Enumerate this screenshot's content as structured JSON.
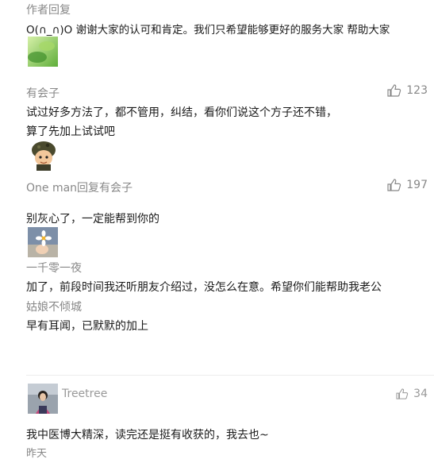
{
  "comments": [
    {
      "author": "作者回复",
      "text": "O(∩_∩)O 谢谢大家的认可和肯定。我们只希望能够更好的服务大家 帮助大家",
      "avatar": "green-leaf-avatar"
    },
    {
      "author": "有会子",
      "likes": "123",
      "text_lines": [
        "试过好多方法了，都不管用，纠结，看你们说这个方子还不错，",
        "算了先加上试试吧"
      ],
      "avatar": "cartoon-soldier-avatar"
    },
    {
      "author": "One man回复有会子",
      "likes": "197",
      "text": "别灰心了，一定能帮到你的",
      "avatar": "flower-hand-avatar"
    },
    {
      "author": "一千零一夜",
      "text": "加了，前段时间我还听朋友介绍过，没怎么在意。希望你们能帮助我老公"
    },
    {
      "author": "姑娘不倾城",
      "text": "早有耳闻，已默默的加上"
    },
    {
      "author": "Treetree",
      "likes": "34",
      "text": "我中医博大精深，读完还是挺有收获的，我去也~",
      "time": "昨天",
      "avatar": "girl-photo-avatar"
    }
  ],
  "icons": {
    "like": "thumbs-up-icon"
  },
  "colors": {
    "name": "#888888",
    "text": "#1a1a1a"
  }
}
